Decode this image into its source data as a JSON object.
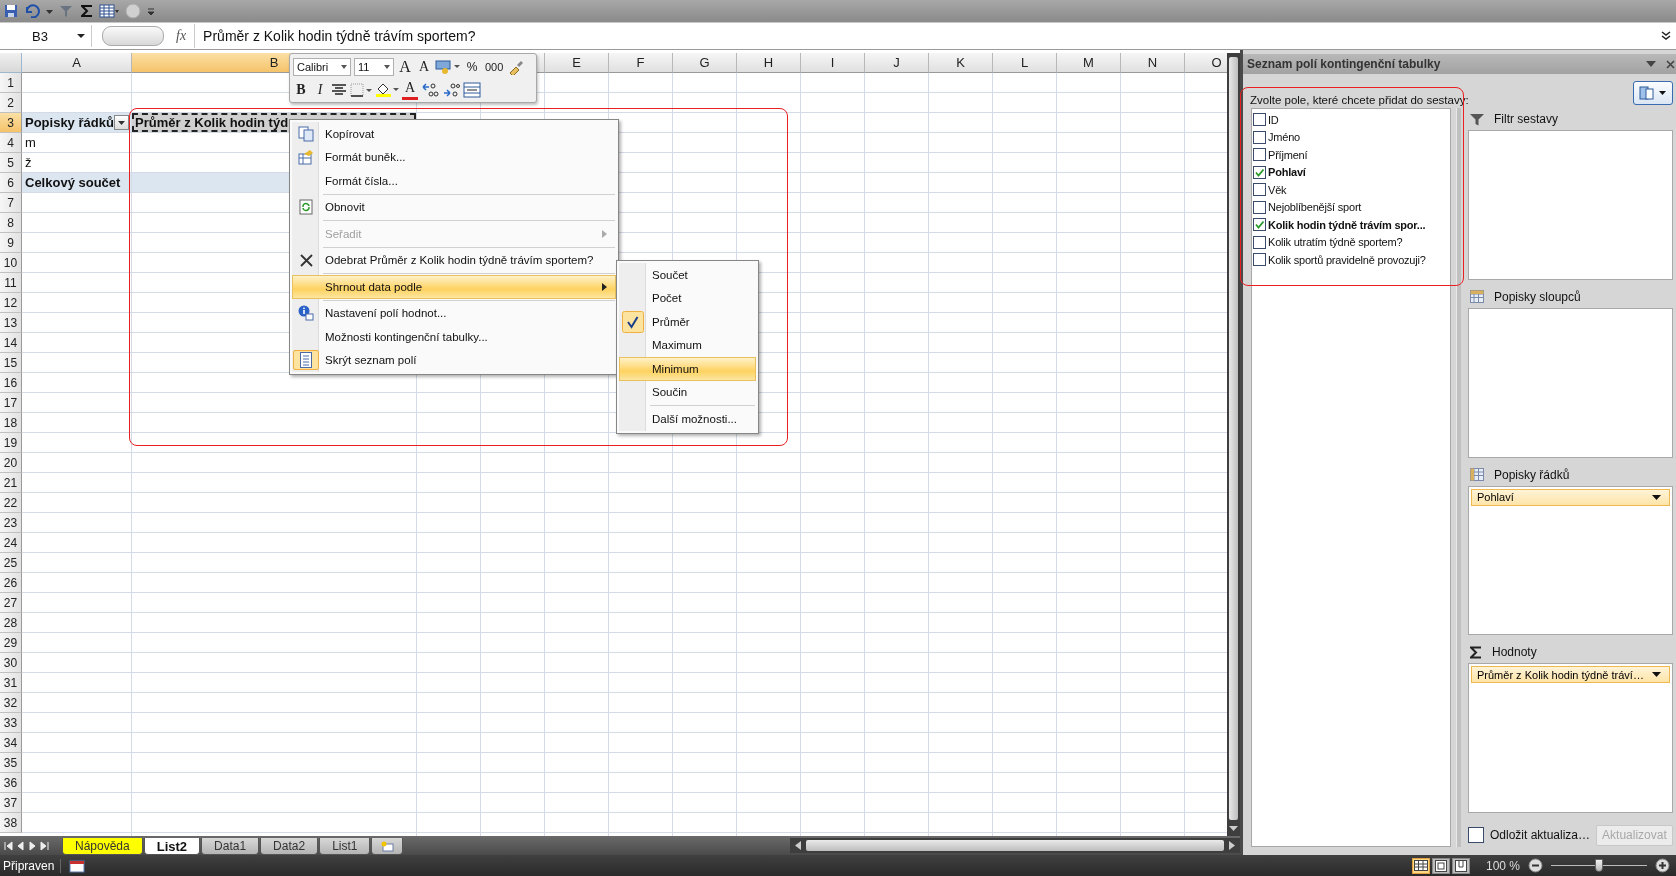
{
  "formula_bar": {
    "name_box": "B3",
    "function_label": "fx",
    "formula": "Průměr z Kolik hodin týdně trávím sportem?"
  },
  "columns": [
    {
      "label": "A",
      "selected": false
    },
    {
      "label": "B",
      "selected": true
    },
    null,
    null,
    {
      "label": "E",
      "selected": false
    },
    {
      "label": "F",
      "selected": false
    },
    {
      "label": "G",
      "selected": false
    },
    {
      "label": "H",
      "selected": false
    },
    {
      "label": "I",
      "selected": false
    },
    {
      "label": "J",
      "selected": false
    },
    {
      "label": "K",
      "selected": false
    },
    {
      "label": "L",
      "selected": false
    },
    {
      "label": "M",
      "selected": false
    },
    {
      "label": "N",
      "selected": false
    },
    {
      "label": "O",
      "selected": false
    }
  ],
  "rows": [
    {
      "number": "1",
      "selected": false
    },
    {
      "number": "2",
      "selected": false
    },
    {
      "number": "3",
      "selected": true,
      "kind": "header",
      "cells": [
        {
          "text": "Popisky řádků",
          "selected": false,
          "filter_button": true
        },
        {
          "text": "Průměr z Kolik hodin týd",
          "selected": true,
          "filter_button": false
        }
      ]
    },
    {
      "number": "4",
      "selected": false,
      "kind": "item",
      "cells": [
        {
          "text": "m",
          "selected": false,
          "filter_button": false
        }
      ]
    },
    {
      "number": "5",
      "selected": false,
      "kind": "item",
      "cells": [
        {
          "text": "ž",
          "selected": false,
          "filter_button": false
        }
      ]
    },
    {
      "number": "6",
      "selected": false,
      "kind": "total",
      "cells": [
        {
          "text": "Celkový součet",
          "selected": false,
          "filter_button": false
        }
      ]
    },
    {
      "number": "7",
      "selected": false
    },
    {
      "number": "8",
      "selected": false
    },
    {
      "number": "9",
      "selected": false
    },
    {
      "number": "10",
      "selected": false
    },
    {
      "number": "11",
      "selected": false
    },
    {
      "number": "12",
      "selected": false
    },
    {
      "number": "13",
      "selected": false
    },
    {
      "number": "14",
      "selected": false
    },
    {
      "number": "15",
      "selected": false
    },
    {
      "number": "16",
      "selected": false
    },
    {
      "number": "17",
      "selected": false
    },
    {
      "number": "18",
      "selected": false
    },
    {
      "number": "19",
      "selected": false
    },
    {
      "number": "20",
      "selected": false
    },
    {
      "number": "21",
      "selected": false
    },
    {
      "number": "22",
      "selected": false
    },
    {
      "number": "23",
      "selected": false
    },
    {
      "number": "24",
      "selected": false
    },
    {
      "number": "25",
      "selected": false
    },
    {
      "number": "26",
      "selected": false
    },
    {
      "number": "27",
      "selected": false
    },
    {
      "number": "28",
      "selected": false
    },
    {
      "number": "29",
      "selected": false
    },
    {
      "number": "30",
      "selected": false
    },
    {
      "number": "31",
      "selected": false
    },
    {
      "number": "32",
      "selected": false
    },
    {
      "number": "33",
      "selected": false
    },
    {
      "number": "34",
      "selected": false
    },
    {
      "number": "35",
      "selected": false
    },
    {
      "number": "36",
      "selected": false
    },
    {
      "number": "37",
      "selected": false
    },
    {
      "number": "38",
      "selected": false
    }
  ],
  "mini_toolbar": {
    "font": "Calibri",
    "size": "11",
    "top_buttons": [
      {
        "kind": "grow",
        "label": "A"
      },
      {
        "kind": "shrink",
        "label": "A"
      },
      {
        "kind": "accounting"
      },
      {
        "kind": "percent",
        "label": "%"
      },
      {
        "kind": "thousands",
        "label": "000"
      },
      {
        "kind": "painter"
      }
    ],
    "bottom_buttons": [
      {
        "kind": "bold",
        "label": "B"
      },
      {
        "kind": "italic",
        "label": "I"
      },
      {
        "kind": "center"
      },
      {
        "kind": "borders"
      },
      {
        "kind": "fill"
      },
      {
        "kind": "font_color",
        "label": "A"
      },
      {
        "kind": "inc_decimal"
      },
      {
        "kind": "dec_decimal"
      },
      {
        "kind": "merge"
      }
    ]
  },
  "context_menu": [
    {
      "label": "Kopírovat",
      "kind": "copy",
      "disabled": false,
      "highlighted": false,
      "checked": false,
      "submenu": false,
      "separator_before": false
    },
    {
      "label": "Formát buněk...",
      "kind": "format",
      "disabled": false,
      "highlighted": false,
      "checked": false,
      "submenu": false,
      "separator_before": false
    },
    {
      "label": "Formát čísla...",
      "kind": "plain",
      "disabled": false,
      "highlighted": false,
      "checked": false,
      "submenu": false,
      "separator_before": false
    },
    {
      "label": "Obnovit",
      "kind": "refresh",
      "disabled": false,
      "highlighted": false,
      "checked": false,
      "submenu": false,
      "separator_before": true
    },
    {
      "label": "Seřadit",
      "kind": "plain",
      "disabled": true,
      "highlighted": false,
      "checked": false,
      "submenu": true,
      "separator_before": true
    },
    {
      "label": "Odebrat Průměr z Kolik hodin týdně trávím sportem?",
      "kind": "remove",
      "disabled": false,
      "highlighted": false,
      "checked": false,
      "submenu": false,
      "separator_before": true
    },
    {
      "label": "Shrnout data podle",
      "kind": "plain",
      "disabled": false,
      "highlighted": true,
      "checked": false,
      "submenu": true,
      "separator_before": true
    },
    {
      "label": "Nastavení polí hodnot...",
      "kind": "info",
      "disabled": false,
      "highlighted": false,
      "checked": false,
      "submenu": false,
      "separator_before": true
    },
    {
      "label": "Možnosti kontingenční tabulky...",
      "kind": "plain",
      "disabled": false,
      "highlighted": false,
      "checked": false,
      "submenu": false,
      "separator_before": false
    },
    {
      "label": "Skrýt seznam polí",
      "kind": "list",
      "disabled": false,
      "highlighted": false,
      "checked": true,
      "submenu": false,
      "separator_before": false
    }
  ],
  "submenu": [
    {
      "label": "Součet",
      "checked": false,
      "highlighted": false,
      "separator_before": false
    },
    {
      "label": "Počet",
      "checked": false,
      "highlighted": false,
      "separator_before": false
    },
    {
      "label": "Průměr",
      "checked": true,
      "highlighted": false,
      "separator_before": false
    },
    {
      "label": "Maximum",
      "checked": false,
      "highlighted": false,
      "separator_before": false
    },
    {
      "label": "Minimum",
      "checked": false,
      "highlighted": true,
      "separator_before": false
    },
    {
      "label": "Součin",
      "checked": false,
      "highlighted": false,
      "separator_before": false
    },
    {
      "label": "Další možnosti...",
      "checked": false,
      "highlighted": false,
      "separator_before": true
    }
  ],
  "pivot_panel": {
    "title": "Seznam polí kontingenční tabulky",
    "prompt": "Zvolte pole, které chcete přidat do sestavy:",
    "fields": [
      {
        "label": "ID",
        "checked": false
      },
      {
        "label": "Jméno",
        "checked": false
      },
      {
        "label": "Příjmení",
        "checked": false
      },
      {
        "label": "Pohlaví",
        "checked": true
      },
      {
        "label": "Věk",
        "checked": false
      },
      {
        "label": "Nejoblíbenější sport",
        "checked": false
      },
      {
        "label": "Kolik hodin týdně trávím spor...",
        "checked": true
      },
      {
        "label": "Kolik utratím týdně sportem?",
        "checked": false
      },
      {
        "label": "Kolik sportů pravidelně provozuji?",
        "checked": false
      }
    ],
    "areas": [
      {
        "kind": "filter",
        "label": "Filtr sestavy"
      },
      {
        "kind": "columns",
        "label": "Popisky sloupců"
      },
      {
        "kind": "rows",
        "label": "Popisky řádků",
        "items": [
          "Pohlaví"
        ]
      },
      {
        "kind": "values",
        "label": "Hodnoty",
        "items": [
          "Průměr z Kolik hodin týdně tráví…"
        ]
      }
    ],
    "defer_update": {
      "label": "Odložit aktualiza…",
      "checked": false
    },
    "update_button": {
      "label": "Aktualizovat",
      "disabled": true
    }
  },
  "sheet_tabs": [
    {
      "label": "Nápověda",
      "selected": false,
      "color": "#ffff00"
    },
    {
      "label": "List2",
      "selected": true
    },
    {
      "label": "Data1",
      "selected": false
    },
    {
      "label": "Data2",
      "selected": false
    },
    {
      "label": "List1",
      "selected": false
    }
  ],
  "status_bar": {
    "status": "Připraven",
    "zoom": "100 %",
    "zoom_slider": {
      "level": 0.5
    },
    "views": [
      {
        "kind": "normal",
        "selected": true
      },
      {
        "kind": "layout",
        "selected": false
      },
      {
        "kind": "break",
        "selected": false
      }
    ]
  }
}
